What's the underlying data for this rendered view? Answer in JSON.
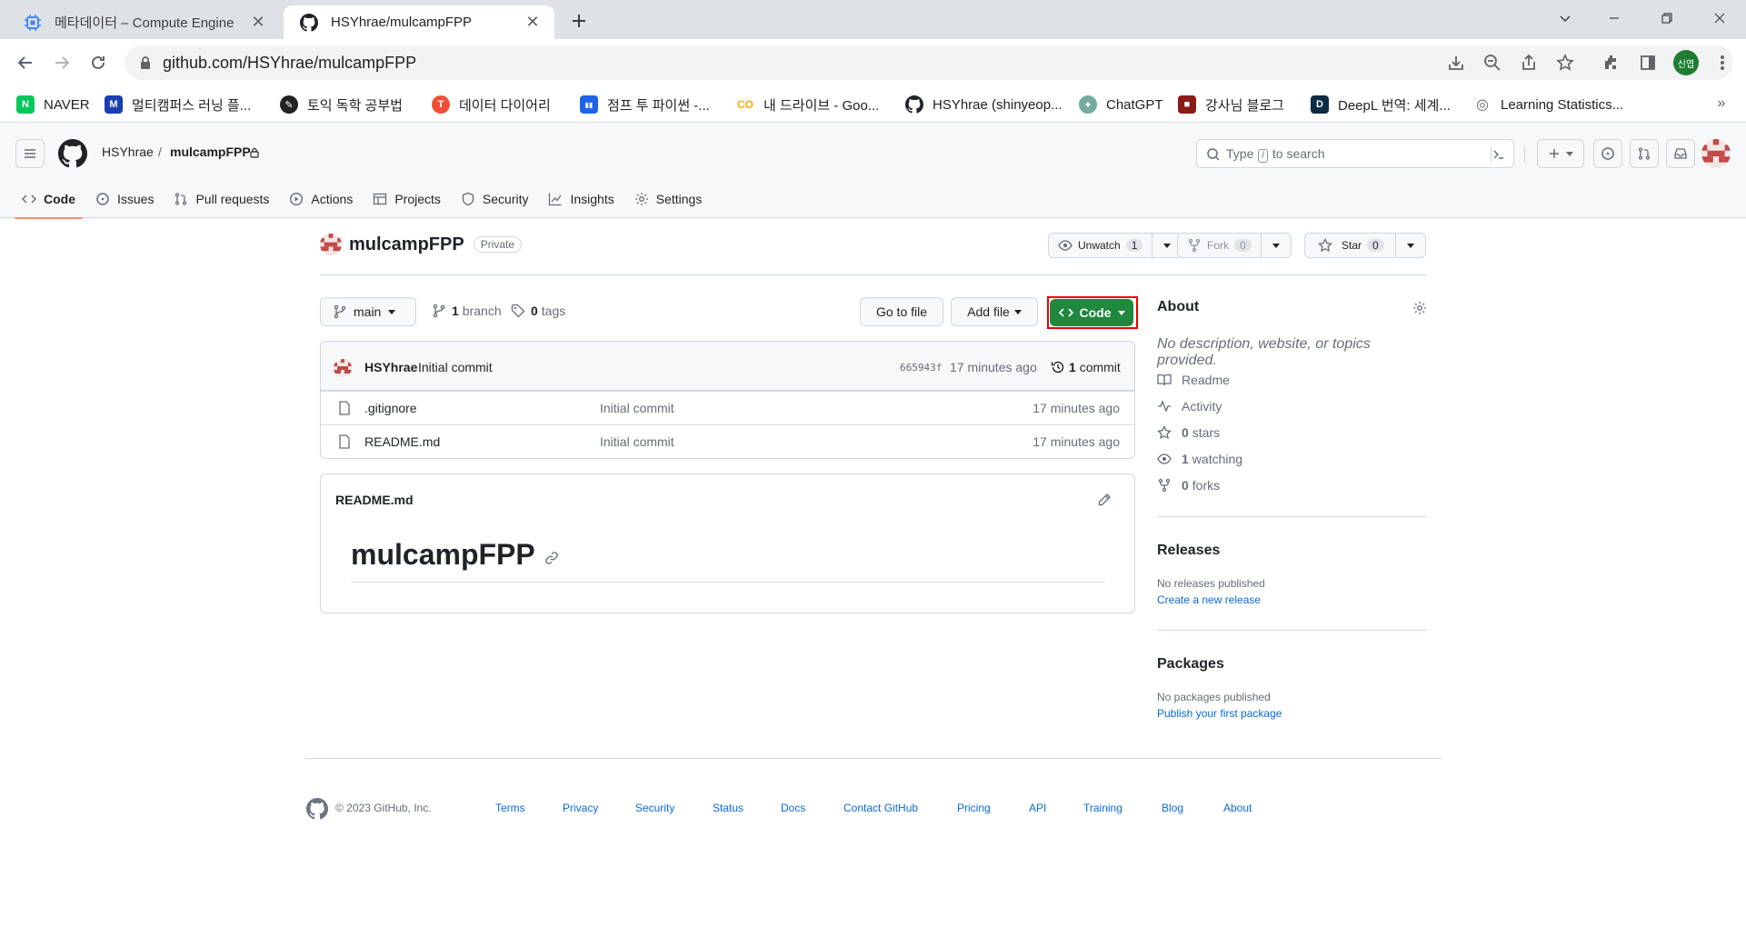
{
  "browser": {
    "tabs": [
      {
        "title": "메타데이터 – Compute Engine",
        "active": false
      },
      {
        "title": "HSYhrae/mulcampFPP",
        "active": true
      }
    ],
    "url": "github.com/HSYhrae/mulcampFPP",
    "profile_label": "신엽",
    "bookmarks": [
      {
        "label": "NAVER",
        "icon": "N",
        "color": "#03c75a"
      },
      {
        "label": "멀티캠퍼스 러닝 플...",
        "icon": "M",
        "color": "#1a3fb3"
      },
      {
        "label": "토익 독학 공부법",
        "icon": "✎",
        "color": "#222222"
      },
      {
        "label": "데이터 다이어리",
        "icon": "T",
        "color": "#f04f37"
      },
      {
        "label": "점프 투 파이썬 -...",
        "icon": "▮▮",
        "color": "#1e64e6"
      },
      {
        "label": "내 드라이브 - Goo...",
        "icon": "CO",
        "color": "#f9ab00"
      },
      {
        "label": "HSYhrae (shinyeop...",
        "icon": "gh",
        "color": "#1f2328"
      },
      {
        "label": "ChatGPT",
        "icon": "✦",
        "color": "#74aa9c"
      },
      {
        "label": "강사님 블로그",
        "icon": "■",
        "color": "#8b1a1a"
      },
      {
        "label": "DeepL 번역: 세계...",
        "icon": "D",
        "color": "#0f2b46"
      },
      {
        "label": "Learning Statistics...",
        "icon": "◎",
        "color": "#5f6368"
      }
    ]
  },
  "gh": {
    "owner": "HSYhrae",
    "separator": "/",
    "repo": "mulcampFPP",
    "search_placeholder_pre": "Type",
    "search_key": "/",
    "search_placeholder_post": "to search",
    "nav": [
      {
        "label": "Code",
        "icon": "code-icon",
        "selected": true
      },
      {
        "label": "Issues",
        "icon": "issue-icon"
      },
      {
        "label": "Pull requests",
        "icon": "pull-request-icon"
      },
      {
        "label": "Actions",
        "icon": "play-icon"
      },
      {
        "label": "Projects",
        "icon": "table-icon"
      },
      {
        "label": "Security",
        "icon": "shield-icon"
      },
      {
        "label": "Insights",
        "icon": "graph-icon"
      },
      {
        "label": "Settings",
        "icon": "gear-icon"
      }
    ]
  },
  "repo": {
    "name": "mulcampFPP",
    "visibility": "Private",
    "unwatch_label": "Unwatch",
    "unwatch_count": "1",
    "fork_label": "Fork",
    "fork_count": "0",
    "star_label": "Star",
    "star_count": "0",
    "branch": "main",
    "branches_count": "1",
    "branches_label": "branch",
    "tags_count": "0",
    "tags_label": "tags",
    "go_to_file": "Go to file",
    "add_file": "Add file",
    "code_label": "Code"
  },
  "commit": {
    "author": "HSYhrae",
    "message": "Initial commit",
    "sha": "665943f",
    "time": "17 minutes ago",
    "count": "1",
    "count_label": "commit"
  },
  "files": [
    {
      "name": ".gitignore",
      "message": "Initial commit",
      "time": "17 minutes ago"
    },
    {
      "name": "README.md",
      "message": "Initial commit",
      "time": "17 minutes ago"
    }
  ],
  "readme": {
    "filename": "README.md",
    "heading": "mulcampFPP"
  },
  "about": {
    "title": "About",
    "description": "No description, website, or topics provided.",
    "readme": "Readme",
    "activity": "Activity",
    "stars_count": "0",
    "stars_label": "stars",
    "watching_count": "1",
    "watching_label": "watching",
    "forks_count": "0",
    "forks_label": "forks"
  },
  "releases": {
    "title": "Releases",
    "empty": "No releases published",
    "create_link": "Create a new release"
  },
  "packages": {
    "title": "Packages",
    "empty": "No packages published",
    "publish_link": "Publish your first package"
  },
  "footer": {
    "copyright": "© 2023 GitHub, Inc.",
    "links": [
      "Terms",
      "Privacy",
      "Security",
      "Status",
      "Docs",
      "Contact GitHub",
      "Pricing",
      "API",
      "Training",
      "Blog",
      "About"
    ]
  }
}
